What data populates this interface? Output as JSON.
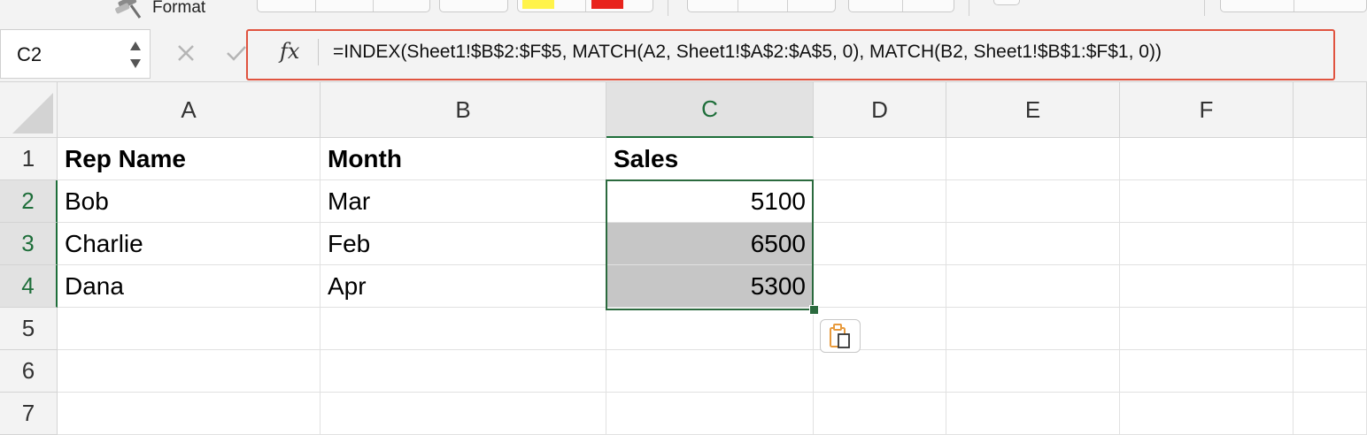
{
  "ribbon": {
    "format_label": "Format"
  },
  "formula_bar": {
    "name_box_value": "C2",
    "fx_label": "fx",
    "formula": "=INDEX(Sheet1!$B$2:$F$5, MATCH(A2, Sheet1!$A$2:$A$5, 0), MATCH(B2, Sheet1!$B$1:$F$1, 0))",
    "highlight_color": "#e0533f"
  },
  "grid": {
    "columns": [
      "A",
      "B",
      "C",
      "D",
      "E",
      "F"
    ],
    "active_column": "C",
    "rows": [
      "1",
      "2",
      "3",
      "4",
      "5",
      "6",
      "7"
    ],
    "active_rows": [
      "2",
      "3",
      "4"
    ],
    "selected_range": "C2:C4",
    "selection_color": "#2b6a3e",
    "cells": {
      "A1": "Rep Name",
      "B1": "Month",
      "C1": "Sales",
      "A2": "Bob",
      "B2": "Mar",
      "C2": "5100",
      "A3": "Charlie",
      "B3": "Feb",
      "C3": "6500",
      "A4": "Dana",
      "B4": "Apr",
      "C4": "5300"
    }
  },
  "icons": {
    "paste_options": "clipboard-icon",
    "format_painter": "paintbrush-icon",
    "cancel": "x-icon",
    "confirm": "checkmark-icon"
  }
}
